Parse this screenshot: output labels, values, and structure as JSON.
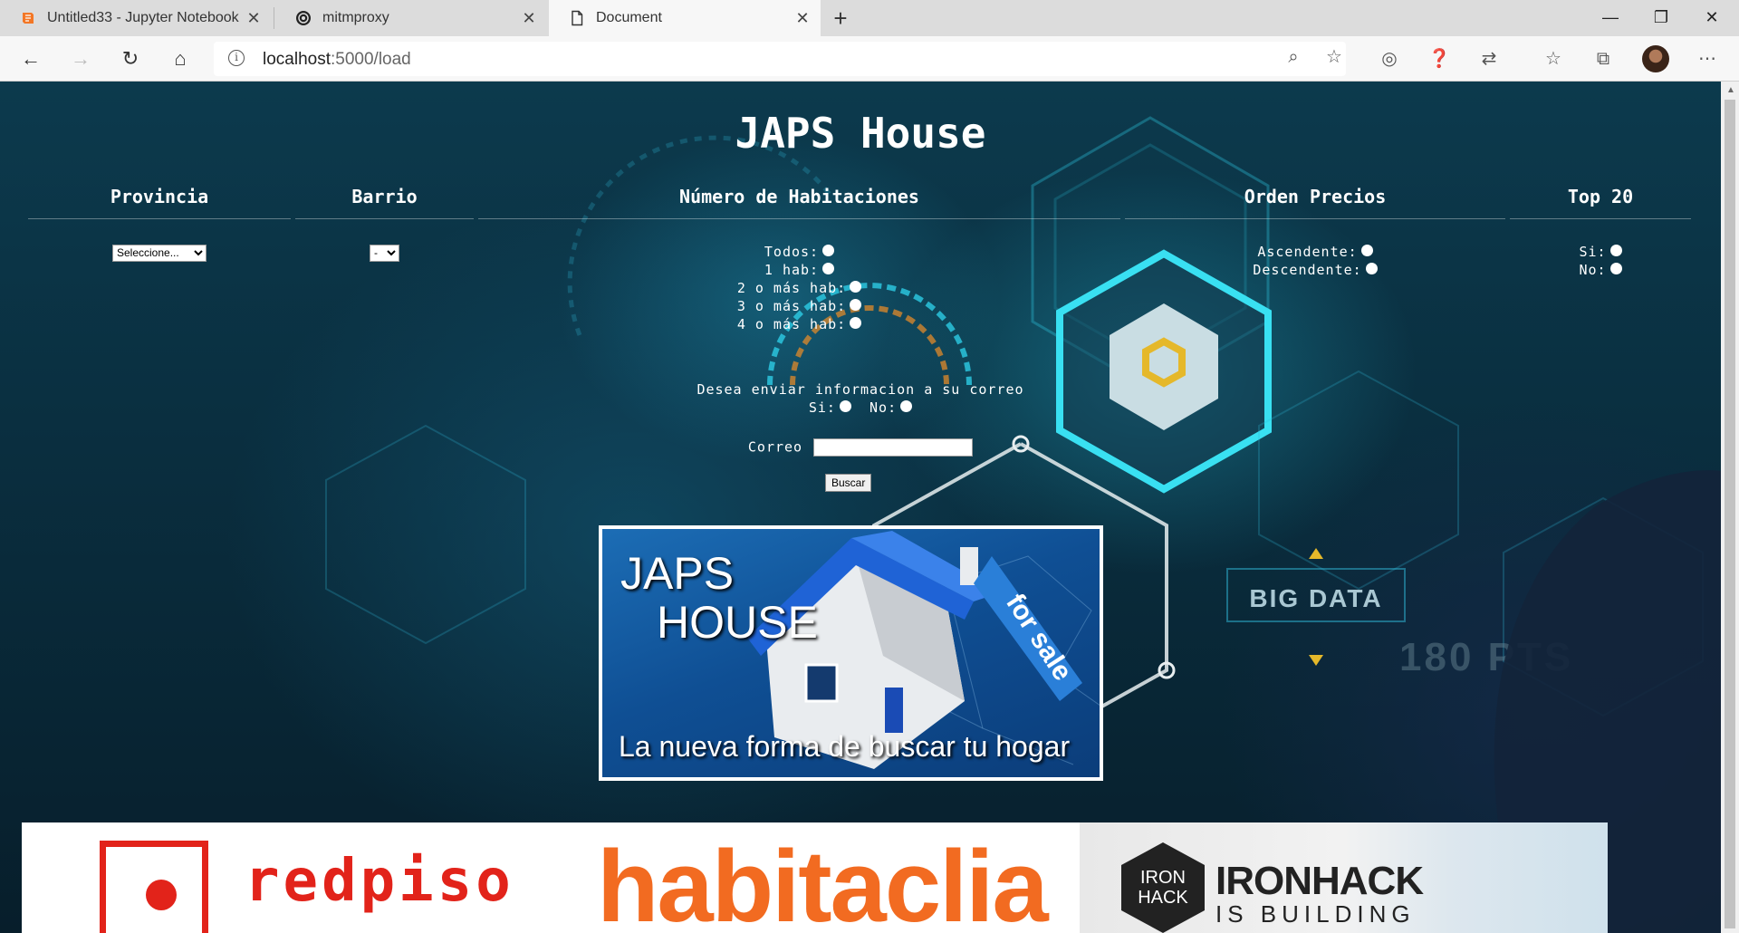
{
  "browser": {
    "tabs": [
      {
        "title": "Untitled33 - Jupyter Notebook",
        "icon": "jupyter-icon",
        "active": false
      },
      {
        "title": "mitmproxy",
        "icon": "mitmproxy-icon",
        "active": false
      },
      {
        "title": "Document",
        "icon": "page-icon",
        "active": true
      }
    ],
    "url_host": "localhost",
    "url_path": ":5000/load"
  },
  "page": {
    "title": "JAPS House",
    "columns": {
      "provincia": {
        "header": "Provincia",
        "select_value": "Seleccione..."
      },
      "barrio": {
        "header": "Barrio",
        "select_value": "-"
      },
      "habitaciones": {
        "header": "Número de Habitaciones",
        "options": [
          "Todos:",
          "1 hab:",
          "2 o más hab:",
          "3 o más hab:",
          "4 o más hab:"
        ]
      },
      "orden": {
        "header": "Orden Precios",
        "options": [
          "Ascendente:",
          "Descendente:"
        ]
      },
      "top20": {
        "header": "Top 20",
        "options": [
          "Si:",
          "No:"
        ]
      }
    },
    "mail": {
      "question": "Desea enviar informacion a su correo",
      "yes_label": "Si:",
      "no_label": "No:",
      "correo_label": "Correo",
      "correo_value": ""
    },
    "search_button": "Buscar",
    "banner": {
      "logo_line1": "JAPS",
      "logo_line2": "HOUSE",
      "tag": "for sale",
      "tagline": "La nueva forma de buscar tu hogar"
    },
    "background": {
      "big_data": "BIG DATA",
      "score": "180 PTS"
    },
    "partners": {
      "redpiso": "redpiso",
      "habitaclia": "habitaclia",
      "ironhack_hex_line1": "IRON",
      "ironhack_hex_line2": "HACK",
      "ironhack_name": "IRONHACK",
      "ironhack_sub": "IS BUILDING"
    }
  },
  "colors": {
    "redpiso": "#e2231a",
    "habitaclia": "#f26b21",
    "banner_blue": "#0f4f94",
    "cyan_glow": "#28c8e6"
  }
}
